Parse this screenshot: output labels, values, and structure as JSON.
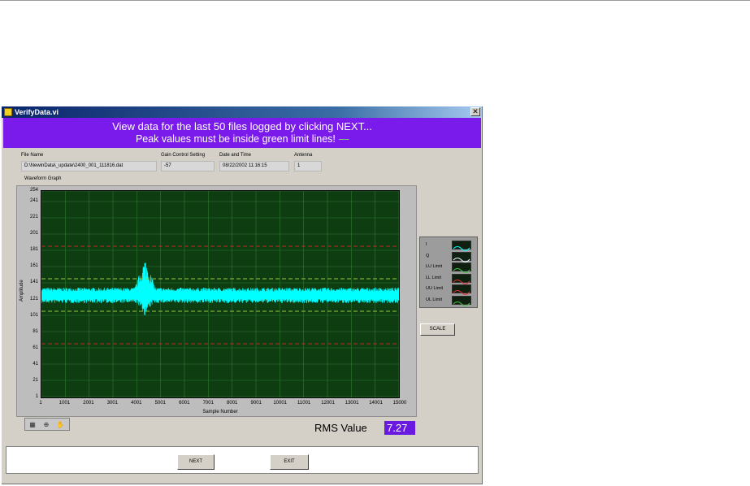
{
  "window": {
    "title": "VerifyData.vi",
    "close_glyph": "✕"
  },
  "banner": {
    "line1": "View data for the last 50 files logged by clicking NEXT...",
    "line2": "Peak values must be inside green limit lines!",
    "line2_dash": "----",
    "background": "#7a1aeb"
  },
  "fields": {
    "file_name": {
      "label": "File Name",
      "value": "D:\\NewinData\\_update\\2400_001_111816.dat"
    },
    "gain": {
      "label": "Gain Control Setting",
      "value": "-57"
    },
    "datetime": {
      "label": "Date and Time",
      "value": "08/22/2002 11:16:15"
    },
    "antenna": {
      "label": "Antenna",
      "value": "1"
    }
  },
  "graph_label": "Waveform Graph",
  "chart_data": {
    "type": "line",
    "xlabel": "Sample Number",
    "ylabel": "Amplitude",
    "xlim": [
      1,
      15000
    ],
    "ylim": [
      0,
      254
    ],
    "x_ticks": [
      "1",
      "1001",
      "2001",
      "3001",
      "4001",
      "5001",
      "6001",
      "7001",
      "8001",
      "9001",
      "10001",
      "11001",
      "12001",
      "13001",
      "14001",
      "15000"
    ],
    "y_ticks": [
      "1",
      "21",
      "41",
      "61",
      "81",
      "101",
      "121",
      "141",
      "161",
      "181",
      "201",
      "221",
      "241",
      "254"
    ],
    "grid": true,
    "background": "#0f3d12",
    "series": [
      {
        "name": "I",
        "color": "#00ffff",
        "baseline": 126,
        "noise_band": [
          116,
          135
        ],
        "burst_range": [
          3800,
          4900
        ],
        "burst_peak": [
          100,
          172
        ]
      },
      {
        "name": "Q",
        "color": "#00ffff",
        "baseline": 126,
        "noise_band": [
          116,
          135
        ]
      },
      {
        "name": "LU Limit",
        "color": "#9acd32",
        "style": "dashed",
        "value": 106
      },
      {
        "name": "LL Limit",
        "color": "#cc2222",
        "style": "dashed",
        "value": 66
      },
      {
        "name": "UU Limit",
        "color": "#cc2222",
        "style": "dashed",
        "value": 186
      },
      {
        "name": "UL Limit",
        "color": "#9acd32",
        "style": "dashed",
        "value": 146
      }
    ]
  },
  "legend": {
    "items": [
      {
        "label": "I",
        "color": "#00ffff"
      },
      {
        "label": "Q",
        "color": "#e8ffff"
      },
      {
        "label": "LU Limit",
        "color": "#40c040"
      },
      {
        "label": "LL Limit",
        "color": "#e03030"
      },
      {
        "label": "UU Limit",
        "color": "#e03030"
      },
      {
        "label": "UL Limit",
        "color": "#40c040"
      }
    ]
  },
  "buttons": {
    "scale": "SCALE",
    "next": "NEXT",
    "exit": "EXIT"
  },
  "palette": {
    "icons": [
      "graph-cursor-icon",
      "zoom-icon",
      "pan-hand-icon"
    ],
    "glyphs": [
      "▦",
      "⊕",
      "✋"
    ]
  },
  "rms": {
    "label": "RMS Value",
    "value": "7.27"
  }
}
